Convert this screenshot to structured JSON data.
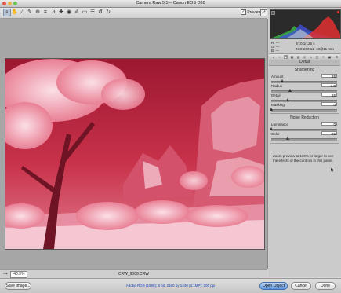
{
  "window": {
    "title": "Camera Raw 5.5 – Canon EOS D30"
  },
  "toolbar": {
    "tools": [
      "zoom-tool",
      "hand-tool",
      "white-balance-tool",
      "color-sampler-tool",
      "target-adjustment-tool",
      "crop-tool",
      "straighten-tool",
      "spot-removal-tool",
      "red-eye-tool",
      "adjustment-brush-tool",
      "graduated-filter-tool",
      "preferences-tool",
      "rotate-left-tool",
      "rotate-right-tool"
    ],
    "preview_label": "Preview",
    "preview_checked": "✓"
  },
  "info": {
    "r_label": "R:",
    "r_val": "---",
    "g_label": "G:",
    "g_val": "---",
    "b_label": "B:",
    "b_val": "---",
    "exposure": "f/10   1/125 s",
    "iso": "ISO 200   11–18@11 mm"
  },
  "panel": {
    "title": "Detail",
    "sharpening_heading": "Sharpening",
    "noise_heading": "Noise Reduction",
    "sliders": [
      {
        "label": "Amount",
        "value": "25",
        "fraction": 0.17
      },
      {
        "label": "Radius",
        "value": "1.0",
        "fraction": 0.28
      },
      {
        "label": "Detail",
        "value": "25",
        "fraction": 0.25
      },
      {
        "label": "Masking",
        "value": "0",
        "fraction": 0.0
      },
      {
        "label": "Luminance",
        "value": "0",
        "fraction": 0.0
      },
      {
        "label": "Color",
        "value": "25",
        "fraction": 0.25
      }
    ],
    "note": "Zoom preview to 100% or larger to see the effects of the controls in this panel."
  },
  "status": {
    "zoom_value": "40.3%",
    "filename": "CRW_9008.CRW"
  },
  "bottom": {
    "save_label": "Save Image...",
    "workflow_link": "Adobe RGB (1998); 8 bit; 2160 by 1440 (3.1MP); 200 ppi",
    "open_label": "Open Object",
    "cancel_label": "Cancel",
    "done_label": "Done"
  },
  "colors": {
    "photo_base": "#c8324a",
    "photo_highlight": "#f7c6d0",
    "primary_button": "#5a95e0"
  }
}
